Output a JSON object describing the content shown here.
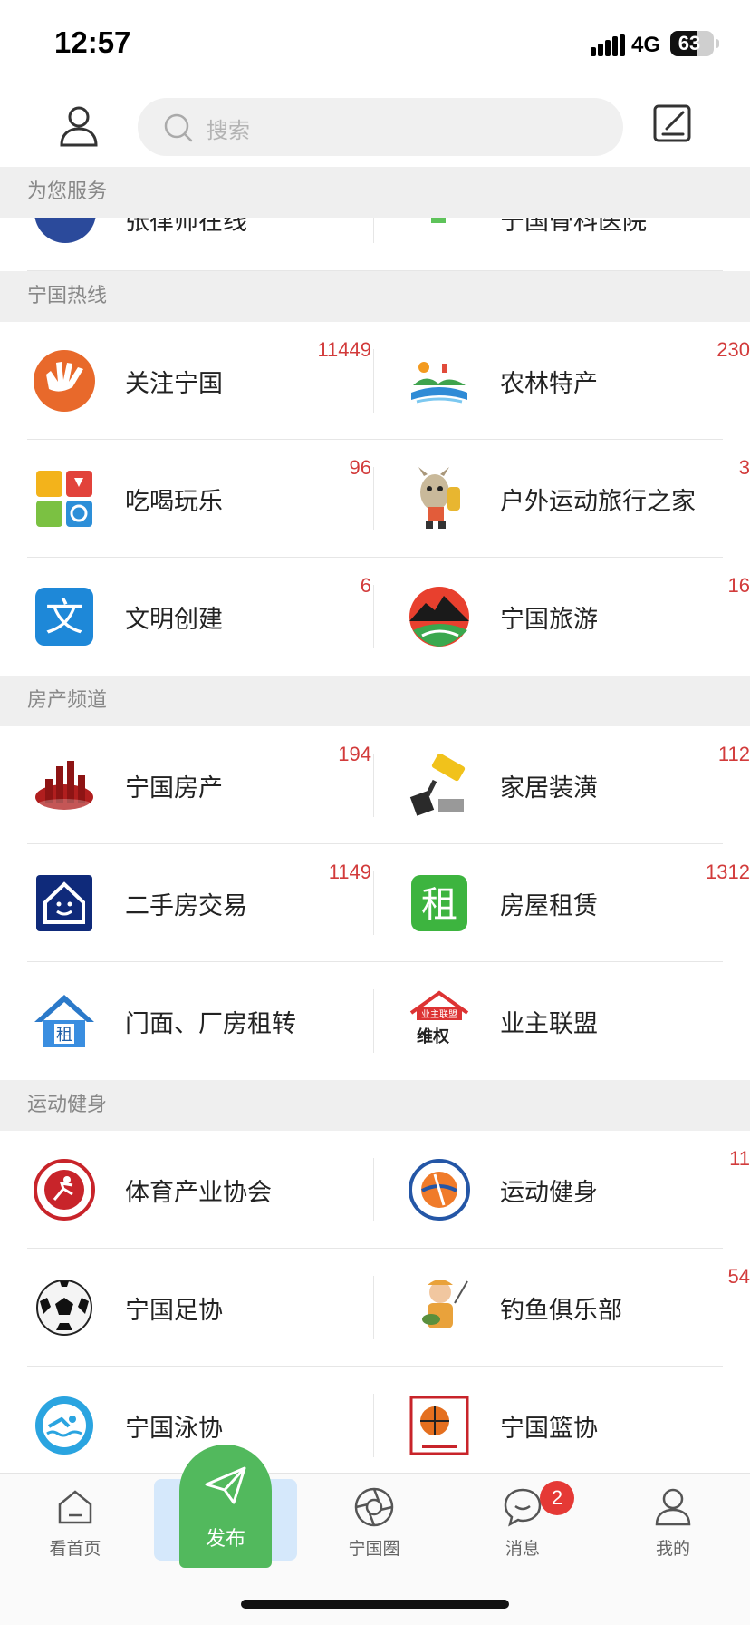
{
  "status": {
    "time": "12:57",
    "network": "4G",
    "battery": "63",
    "battery_level": 0.63
  },
  "header": {
    "search_placeholder": "搜索"
  },
  "sections": [
    {
      "title": "为您服务",
      "partial": {
        "left": "张律师在线",
        "right": "宁国骨科医院"
      }
    },
    {
      "title": "宁国热线",
      "rows": [
        [
          {
            "label": "关注宁国",
            "count": "11449",
            "icon": "orange-hand-logo-icon"
          },
          {
            "label": "农林特产",
            "count": "230",
            "icon": "landscape-icon"
          }
        ],
        [
          {
            "label": "吃喝玩乐",
            "count": "96",
            "icon": "grid-activities-icon"
          },
          {
            "label": "户外运动旅行之家",
            "count": "3",
            "icon": "donkey-hiker-icon"
          }
        ],
        [
          {
            "label": "文明创建",
            "count": "6",
            "icon": "wen-character-icon"
          },
          {
            "label": "宁国旅游",
            "count": "16",
            "icon": "mountain-tour-icon"
          }
        ]
      ]
    },
    {
      "title": "房产频道",
      "rows": [
        [
          {
            "label": "宁国房产",
            "count": "194",
            "icon": "buildings-icon"
          },
          {
            "label": "家居装潢",
            "count": "112",
            "icon": "paint-roller-icon"
          }
        ],
        [
          {
            "label": "二手房交易",
            "count": "1149",
            "icon": "house-smile-icon"
          },
          {
            "label": "房屋租赁",
            "count": "1312",
            "icon": "zu-rent-icon"
          }
        ],
        [
          {
            "label": "门面、厂房租转",
            "count": "",
            "icon": "house-rent-icon"
          },
          {
            "label": "业主联盟",
            "count": "",
            "icon": "owner-alliance-icon",
            "logo_text": "业主联盟",
            "logo_sub": "维权"
          }
        ]
      ]
    },
    {
      "title": "运动健身",
      "rows": [
        [
          {
            "label": "体育产业协会",
            "count": "",
            "icon": "sports-association-icon"
          },
          {
            "label": "运动健身",
            "count": "11",
            "icon": "fitness-logo-icon"
          }
        ],
        [
          {
            "label": "宁国足协",
            "count": "",
            "icon": "soccer-ball-icon"
          },
          {
            "label": "钓鱼俱乐部",
            "count": "54",
            "icon": "fishing-icon"
          }
        ],
        [
          {
            "label": "宁国泳协",
            "count": "",
            "icon": "swimming-icon"
          },
          {
            "label": "宁国篮协",
            "count": "",
            "icon": "basketball-icon"
          }
        ]
      ]
    }
  ],
  "tabbar": {
    "home": "看首页",
    "publish": "发布",
    "circle": "宁国圈",
    "messages": "消息",
    "messages_badge": "2",
    "mine": "我的"
  }
}
